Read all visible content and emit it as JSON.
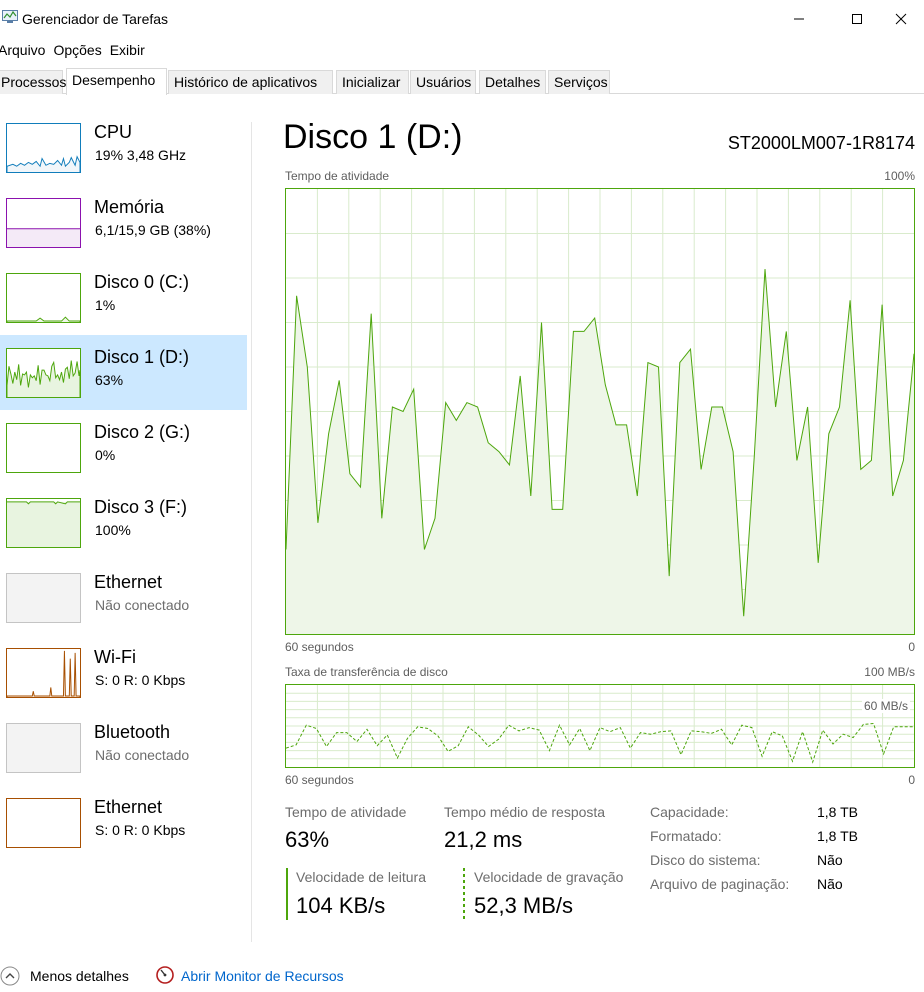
{
  "window": {
    "title": "Gerenciador de Tarefas"
  },
  "menu": [
    "Arquivo",
    "Opções",
    "Exibir"
  ],
  "tabs": [
    "Processos",
    "Desempenho",
    "Histórico de aplicativos",
    "Inicializar",
    "Usuários",
    "Detalhes",
    "Serviços"
  ],
  "active_tab": "Desempenho",
  "sidebar": {
    "items": [
      {
        "name": "CPU",
        "sub": "19%  3,48 GHz",
        "kind": "cpu",
        "color": "#117dbb"
      },
      {
        "name": "Memória",
        "sub": "6,1/15,9 GB (38%)",
        "kind": "memory",
        "color": "#8b12ae"
      },
      {
        "name": "Disco 0 (C:)",
        "sub": "1%",
        "kind": "disk",
        "color": "#4da60c"
      },
      {
        "name": "Disco 1 (D:)",
        "sub": "63%",
        "kind": "disk",
        "color": "#4da60c",
        "selected": true
      },
      {
        "name": "Disco 2 (G:)",
        "sub": "0%",
        "kind": "disk",
        "color": "#4da60c"
      },
      {
        "name": "Disco 3 (F:)",
        "sub": "100%",
        "kind": "disk",
        "color": "#4da60c"
      },
      {
        "name": "Ethernet",
        "sub": "Não conectado",
        "kind": "disconnected",
        "color": "#9b9b9b"
      },
      {
        "name": "Wi-Fi",
        "sub": "S: 0  R: 0 Kbps",
        "kind": "network",
        "color": "#a74f01"
      },
      {
        "name": "Bluetooth",
        "sub": "Não conectado",
        "kind": "disconnected",
        "color": "#9b9b9b"
      },
      {
        "name": "Ethernet",
        "sub": "S: 0  R: 0 Kbps",
        "kind": "network",
        "color": "#a74f01"
      }
    ]
  },
  "main": {
    "title": "Disco 1 (D:)",
    "model": "ST2000LM007-1R8174",
    "activity_graph": {
      "label": "Tempo de atividade",
      "max_label": "100%",
      "x_left_label": "60 segundos",
      "x_right_label": "0"
    },
    "transfer_graph": {
      "label": "Taxa de transferência de disco",
      "max_label": "100 MB/s",
      "inner_label": "60 MB/s",
      "x_left_label": "60 segundos",
      "x_right_label": "0"
    },
    "stats": {
      "activity_label": "Tempo de atividade",
      "activity_value": "63%",
      "response_label": "Tempo médio de resposta",
      "response_value": "21,2 ms",
      "read_label": "Velocidade de leitura",
      "read_value": "104 KB/s",
      "write_label": "Velocidade de gravação",
      "write_value": "52,3 MB/s"
    },
    "properties": [
      {
        "label": "Capacidade:",
        "value": "1,8 TB"
      },
      {
        "label": "Formatado:",
        "value": "1,8 TB"
      },
      {
        "label": "Disco do sistema:",
        "value": "Não"
      },
      {
        "label": "Arquivo de paginação:",
        "value": "Não"
      }
    ]
  },
  "footer": {
    "fewer_details": "Menos detalhes",
    "open_resmon": "Abrir Monitor de Recursos"
  },
  "chart_data": [
    {
      "type": "area",
      "title": "Tempo de atividade",
      "ylabel": "%",
      "ylim": [
        0,
        100
      ],
      "xlim": [
        60,
        0
      ],
      "grid": true,
      "series": [
        {
          "name": "Tempo de atividade",
          "values": [
            19,
            76,
            60,
            25,
            45,
            57,
            36,
            33,
            72,
            26,
            51,
            50,
            55,
            19,
            26,
            52,
            48,
            52,
            51,
            43,
            41,
            38,
            58,
            31,
            70,
            28,
            28,
            68,
            68,
            71,
            56,
            47,
            47,
            31,
            61,
            60,
            13,
            61,
            64,
            37,
            51,
            51,
            41,
            4,
            40,
            82,
            51,
            68,
            39,
            51,
            16,
            45,
            51,
            75,
            37,
            39,
            74,
            31,
            39,
            63
          ]
        }
      ]
    },
    {
      "type": "line",
      "title": "Taxa de transferência de disco",
      "ylabel": "MB/s",
      "ylim": [
        0,
        100
      ],
      "xlim": [
        60,
        0
      ],
      "grid": true,
      "series": [
        {
          "name": "Velocidade de gravação",
          "values": [
            23,
            27,
            51,
            47,
            25,
            42,
            42,
            31,
            46,
            26,
            39,
            11,
            35,
            49,
            47,
            38,
            19,
            26,
            49,
            39,
            25,
            34,
            51,
            44,
            48,
            45,
            20,
            51,
            27,
            47,
            20,
            48,
            43,
            48,
            23,
            42,
            40,
            43,
            44,
            15,
            44,
            43,
            41,
            46,
            27,
            51,
            48,
            13,
            43,
            38,
            7,
            43,
            6,
            45,
            28,
            40,
            36,
            52,
            53,
            16,
            49,
            49,
            49
          ]
        }
      ]
    }
  ]
}
